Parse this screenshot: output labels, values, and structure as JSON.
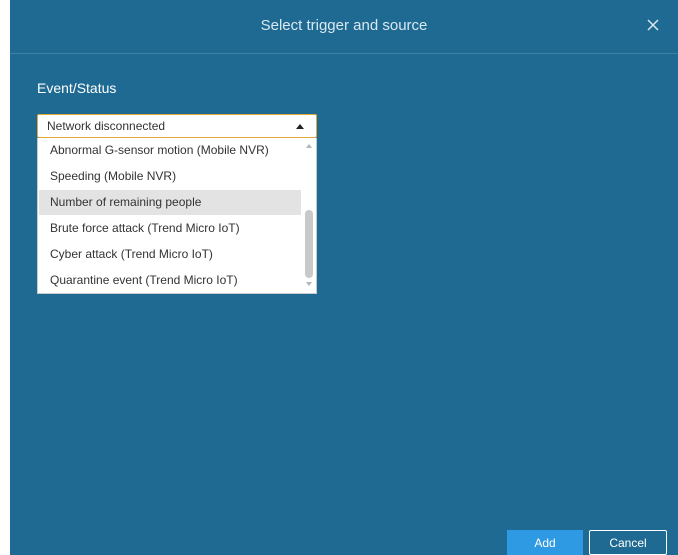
{
  "dialog": {
    "title": "Select trigger and source"
  },
  "event": {
    "label": "Event/Status",
    "selected": "Network disconnected",
    "options": [
      "Abnormal G-sensor motion (Mobile NVR)",
      "Speeding (Mobile NVR)",
      "Number of remaining people",
      "Brute force attack (Trend Micro IoT)",
      "Cyber attack (Trend Micro IoT)",
      "Quarantine event (Trend Micro IoT)"
    ]
  },
  "buttons": {
    "add": "Add",
    "cancel": "Cancel"
  },
  "colors": {
    "background": "#1f6a92",
    "select_border": "#e2a93a",
    "primary_button": "#2e9ae3",
    "highlight": "#e3e3e3"
  },
  "icons": {
    "close": "close-icon",
    "dropdown": "caret-up-icon"
  }
}
